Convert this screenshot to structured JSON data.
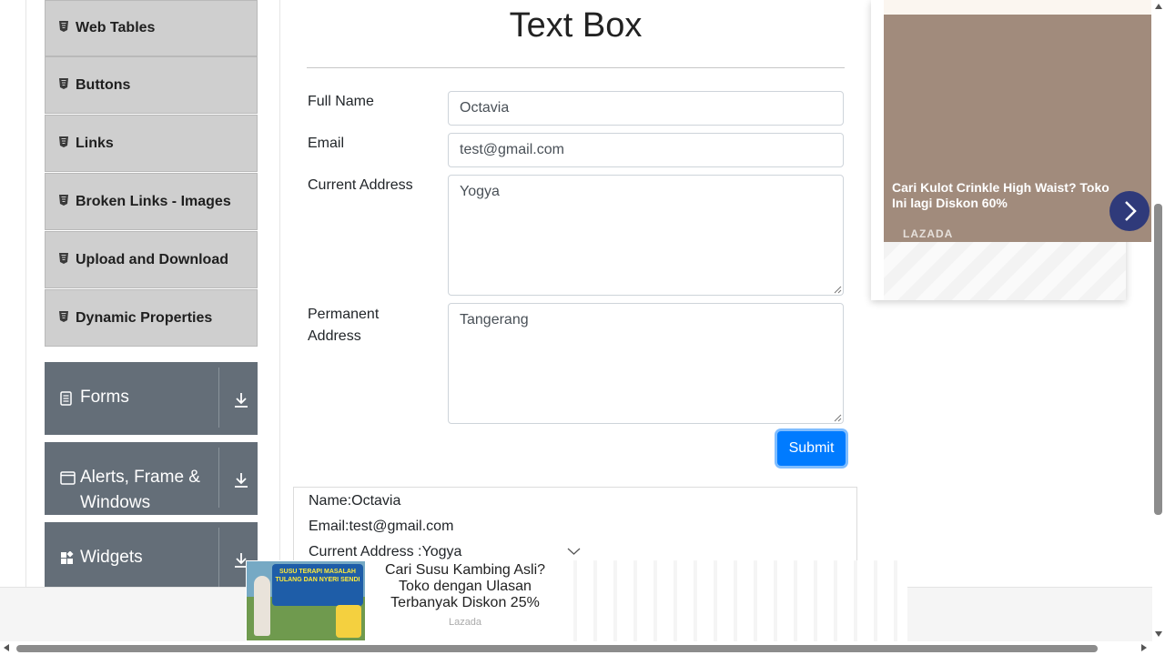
{
  "sidebar": {
    "elements_items": [
      {
        "label": "Web Tables"
      },
      {
        "label": "Buttons"
      },
      {
        "label": "Links"
      },
      {
        "label": "Broken Links - Images"
      },
      {
        "label": "Upload and Download"
      },
      {
        "label": "Dynamic Properties"
      }
    ],
    "groups": [
      {
        "label": "Forms",
        "icon": "document-icon"
      },
      {
        "label": "Alerts, Frame & Windows",
        "icon": "window-icon"
      },
      {
        "label": "Widgets",
        "icon": "widgets-icon"
      }
    ]
  },
  "form": {
    "title": "Text Box",
    "full_name_label": "Full Name",
    "full_name_value": "Octavia",
    "email_label": "Email",
    "email_value": "test@gmail.com",
    "current_address_label": "Current Address",
    "current_address_value": "Yogya",
    "permanent_address_label": "Permanent Address",
    "permanent_address_value": "Tangerang",
    "submit_label": "Submit"
  },
  "output": {
    "name_line": "Name:Octavia",
    "email_line": "Email:test@gmail.com",
    "current_address_line": "Current Address :Yogya"
  },
  "side_ad": {
    "text": "Cari Kulot Crinkle High Waist? Toko Ini lagi Diskon 60%",
    "brand": "LAZADA"
  },
  "bottom_ad": {
    "text": "Cari Susu Kambing Asli? Toko dengan Ulasan Terbanyak Diskon 25%",
    "brand": "Lazada",
    "image_badge": "SUSU TERAPI MASALAH TULANG DAN NYERI SENDI"
  },
  "colors": {
    "accent": "#007bff",
    "sidebar_group": "#646e78",
    "sidebar_item": "#cfcfcf"
  }
}
